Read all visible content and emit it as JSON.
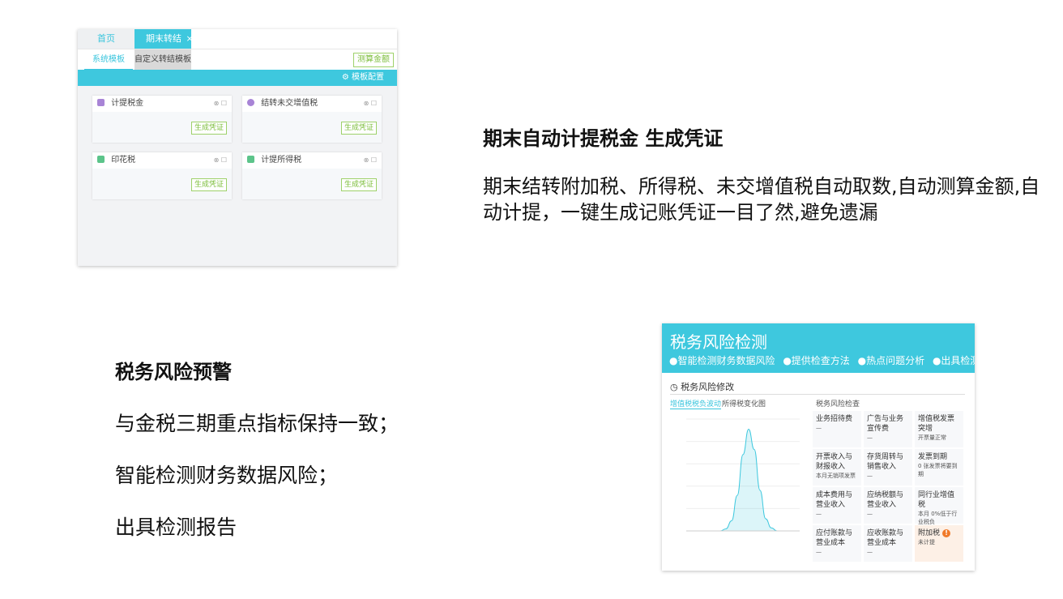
{
  "template_panel": {
    "tabs": [
      "首页",
      "期末转结"
    ],
    "close_icon": "×",
    "subtabs": [
      "系统模板",
      "自定义转结模板"
    ],
    "calc_button": "测算金额",
    "config_label": "模板配置",
    "cards": [
      {
        "title": "计提税金",
        "button": "生成凭证",
        "icon_color": "#a884d6"
      },
      {
        "title": "结转未交增值税",
        "button": "生成凭证",
        "icon_color": "#a884d6"
      },
      {
        "title": "印花税",
        "button": "生成凭证",
        "icon_color": "#5cc48a"
      },
      {
        "title": "计提所得税",
        "button": "生成凭证",
        "icon_color": "#5cc48a"
      }
    ]
  },
  "feature1": {
    "title": "期末自动计提税金 生成凭证",
    "desc": "期末结转附加税、所得税、未交增值税自动取数,自动测算金额,自动计提，一键生成记账凭证一目了然,避免遗漏"
  },
  "feature2": {
    "title": "税务风险预警",
    "points": [
      "与金税三期重点指标保持一致；",
      "智能检测财务数据风险；",
      "出具检测报告"
    ]
  },
  "risk_panel": {
    "title": "税务风险检测",
    "features": [
      "●智能检测财务数据风险",
      "●提供检查方法",
      "●热点问题分析",
      "●出具检测报告"
    ],
    "section": "税务风险修改",
    "chart_tabs": [
      "增值税税负波动",
      "所得税变化图"
    ],
    "check_title": "税务风险检查",
    "cells": [
      {
        "title": "业务招待费",
        "sub": "—"
      },
      {
        "title": "广告与业务宣传费",
        "sub": "—"
      },
      {
        "title": "增值税发票突增",
        "sub": "开票量正常"
      },
      {
        "title": "开票收入与财报收入",
        "sub": "本月无销项发票"
      },
      {
        "title": "存货周转与销售收入",
        "sub": "—"
      },
      {
        "title": "发票到期",
        "sub": "0 张发票将要到期"
      },
      {
        "title": "成本费用与营业收入",
        "sub": "—"
      },
      {
        "title": "应纳税额与营业收入",
        "sub": "—"
      },
      {
        "title": "同行业增值税",
        "sub": "本月 0%低于行业税负1.500000%"
      },
      {
        "title": "应付账款与营业成本",
        "sub": "—"
      },
      {
        "title": "应收账款与营业成本",
        "sub": "—"
      },
      {
        "title": "附加税",
        "sub": "未计提",
        "warn": true
      }
    ],
    "warn_icon": "!"
  },
  "chart_data": {
    "type": "area",
    "x": [
      0,
      1,
      2,
      3,
      4,
      5,
      6,
      7,
      8,
      9,
      10,
      11,
      12,
      13,
      14,
      15,
      16,
      17,
      18,
      19,
      20
    ],
    "values": [
      0,
      0,
      0,
      0,
      0,
      0,
      0,
      0.02,
      0.1,
      0.35,
      0.75,
      1.0,
      0.8,
      0.4,
      0.12,
      0.03,
      0,
      0,
      0,
      0,
      0
    ],
    "ylim": [
      0,
      1.1
    ],
    "grid": true,
    "color": "#3ec8de"
  }
}
